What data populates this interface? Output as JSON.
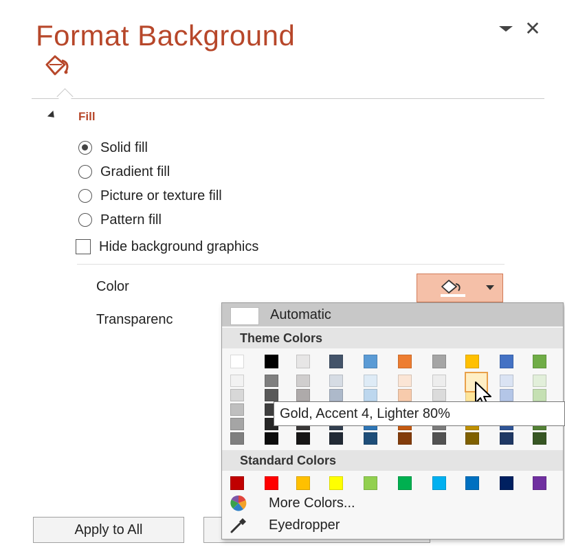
{
  "pane": {
    "title": "Format Background",
    "close_glyph": "✕",
    "tab_icon": "paint-bucket-icon",
    "accent_color": "#b7472a"
  },
  "fill": {
    "section_label": "Fill",
    "options": [
      {
        "label": "Solid fill",
        "selected": true
      },
      {
        "label": "Gradient fill",
        "selected": false
      },
      {
        "label": "Picture or texture fill",
        "selected": false
      },
      {
        "label": "Pattern fill",
        "selected": false
      }
    ],
    "hide_background_graphics": {
      "label": "Hide background graphics",
      "checked": false
    },
    "color_label": "Color",
    "transparency_label": "Transparenc",
    "color_button_fill": "#f5c0a8"
  },
  "palette": {
    "automatic_label": "Automatic",
    "theme_header": "Theme Colors",
    "standard_header": "Standard Colors",
    "theme_base": [
      "#ffffff",
      "#000000",
      "#e7e6e6",
      "#44546a",
      "#5b9bd5",
      "#ed7d31",
      "#a5a5a5",
      "#ffc000",
      "#4472c4",
      "#70ad47"
    ],
    "theme_shades": [
      [
        "#f2f2f2",
        "#7f7f7f",
        "#d0cece",
        "#d6dce4",
        "#deebf6",
        "#fbe5d5",
        "#ededed",
        "#fff2cc",
        "#dae3f3",
        "#e2efda"
      ],
      [
        "#d8d8d8",
        "#595959",
        "#aeaaaa",
        "#adb9ca",
        "#bdd7ee",
        "#f7cbac",
        "#dbdbdb",
        "#fee599",
        "#b4c6e7",
        "#c5e0b3"
      ],
      [
        "#bfbfbf",
        "#3f3f3f",
        "#757070",
        "#8496b0",
        "#9dc3e6",
        "#f4b183",
        "#c9c9c9",
        "#ffd965",
        "#8eaadb",
        "#a8d08d"
      ],
      [
        "#a5a5a5",
        "#262626",
        "#3a3838",
        "#323f4f",
        "#2e75b5",
        "#c55a11",
        "#7b7b7b",
        "#bf9000",
        "#2f5496",
        "#538135"
      ],
      [
        "#7f7f7f",
        "#0c0c0c",
        "#171616",
        "#222a35",
        "#1e4e79",
        "#833c0b",
        "#525252",
        "#7f6000",
        "#1f3864",
        "#375623"
      ]
    ],
    "standard": [
      "#c00000",
      "#ff0000",
      "#ffc000",
      "#ffff00",
      "#92d050",
      "#00b050",
      "#00b0f0",
      "#0070c0",
      "#002060",
      "#7030a0"
    ],
    "tooltip": "Gold, Accent 4, Lighter 80%",
    "more_colors_label": "More Colors...",
    "eyedropper_label": "Eyedropper"
  },
  "footer": {
    "apply_all_label": "Apply to All"
  }
}
